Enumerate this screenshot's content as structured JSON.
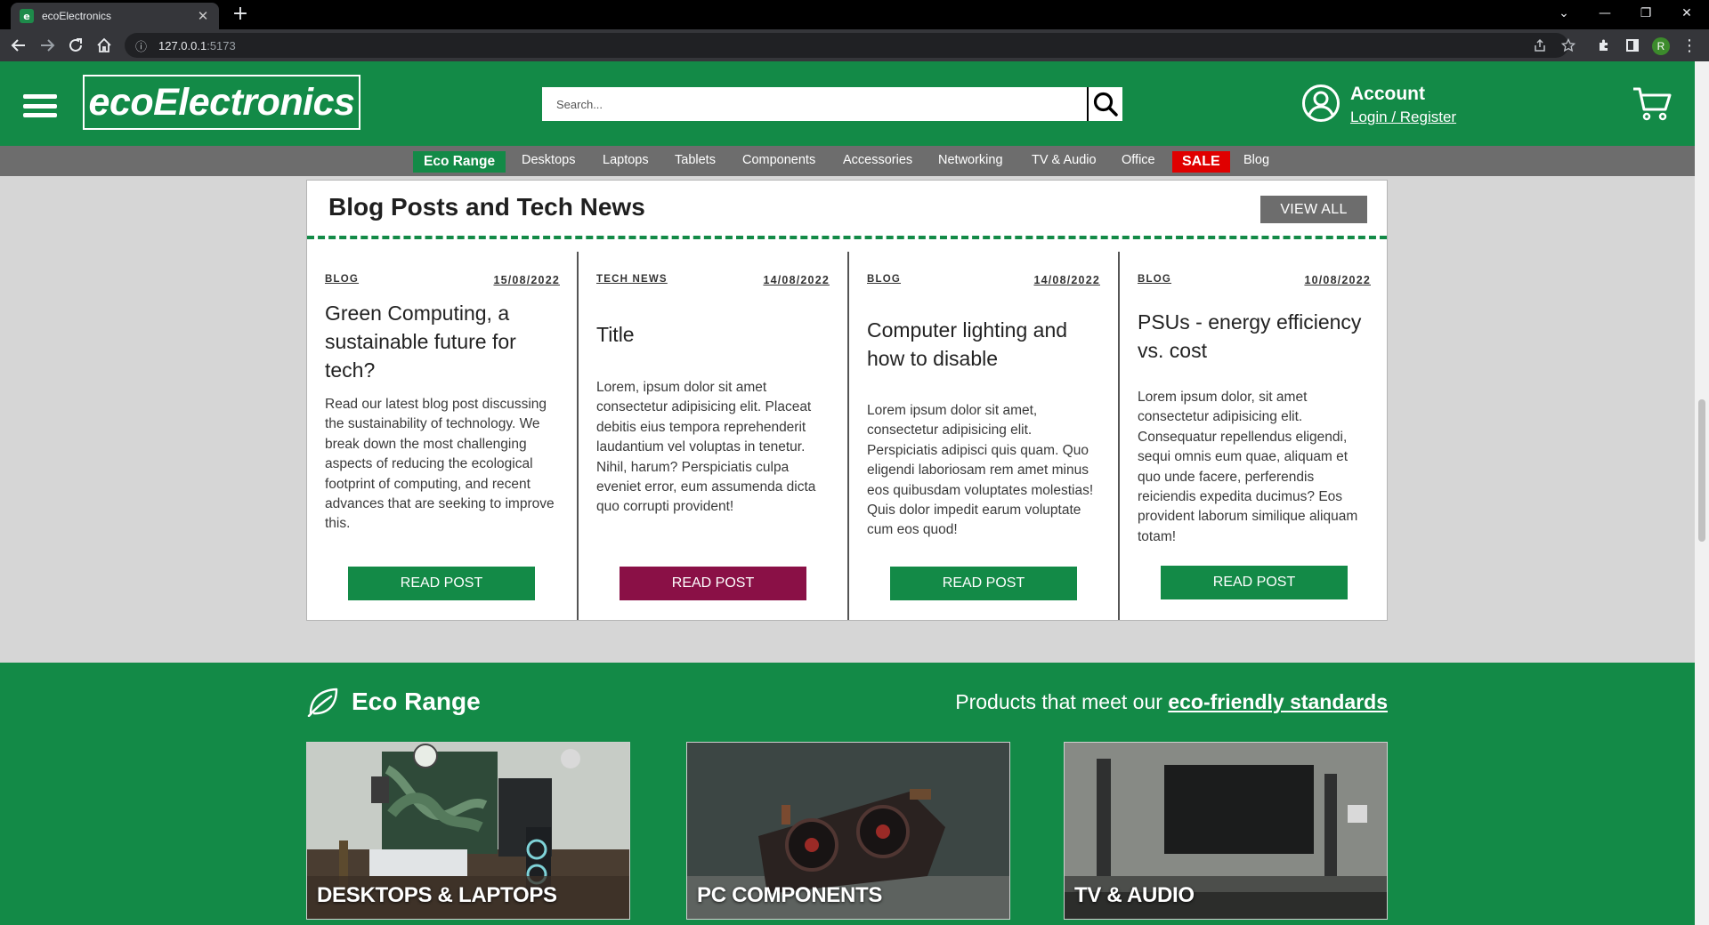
{
  "browser": {
    "tab_title": "ecoElectronics",
    "url_host": "127.0.0.1",
    "url_port": ":5173",
    "profile_initial": "R"
  },
  "header": {
    "logo": "ecoElectronics",
    "search_placeholder": "Search...",
    "account_title": "Account",
    "account_link": "Login / Register"
  },
  "nav": {
    "items": [
      "Eco Range",
      "Desktops",
      "Laptops",
      "Tablets",
      "Components",
      "Accessories",
      "Networking",
      "TV & Audio",
      "Office",
      "SALE",
      "Blog"
    ]
  },
  "blog": {
    "title": "Blog Posts and Tech News",
    "view_all": "VIEW ALL",
    "read_label": "READ POST",
    "posts": [
      {
        "tag": "BLOG",
        "date": "15/08/2022",
        "title": "Green Computing, a sustainable future for tech?",
        "body": "Read our latest blog post discussing the sustainability of technology. We break down the most challenging aspects of reducing the ecological footprint of computing, and recent advances that are seeking to improve this."
      },
      {
        "tag": "TECH NEWS",
        "date": "14/08/2022",
        "title": "Title",
        "body": "Lorem, ipsum dolor sit amet consectetur adipisicing elit. Placeat debitis eius tempora reprehenderit laudantium vel voluptas in tenetur. Nihil, harum? Perspiciatis culpa eveniet error, eum assumenda dicta quo corrupti provident!"
      },
      {
        "tag": "BLOG",
        "date": "14/08/2022",
        "title": "Computer lighting and how to disable",
        "body": "Lorem ipsum dolor sit amet, consectetur adipisicing elit. Perspiciatis adipisci quis quam. Quo eligendi laboriosam rem amet minus eos quibusdam voluptates molestias! Quis dolor impedit earum voluptate cum eos quod!"
      },
      {
        "tag": "BLOG",
        "date": "10/08/2022",
        "title": "PSUs - energy efficiency vs. cost",
        "body": "Lorem ipsum dolor, sit amet consectetur adipisicing elit. Consequatur repellendus eligendi, sequi omnis eum quae, aliquam et quo unde facere, perferendis reiciendis expedita ducimus? Eos provident laborum similique aliquam totam!"
      }
    ]
  },
  "eco": {
    "title": "Eco Range",
    "subtitle_prefix": "Products that meet our ",
    "subtitle_link": "eco-friendly standards",
    "cards": [
      "DESKTOPS & LAPTOPS",
      "PC COMPONENTS",
      "TV & AUDIO"
    ]
  },
  "colors": {
    "brand_green": "#138a47",
    "nav_grey": "#6d6d6d",
    "sale_red": "#e00000",
    "read_alt": "#8a1046"
  },
  "icons": [
    "favicon-icon",
    "close-icon",
    "plus-icon",
    "back-icon",
    "forward-icon",
    "reload-icon",
    "home-icon",
    "info-icon",
    "share-icon",
    "star-icon",
    "extension-icon",
    "sidepanel-icon",
    "menu-dots-icon",
    "hamburger-icon",
    "search-icon",
    "account-icon",
    "cart-icon",
    "leaf-icon"
  ]
}
